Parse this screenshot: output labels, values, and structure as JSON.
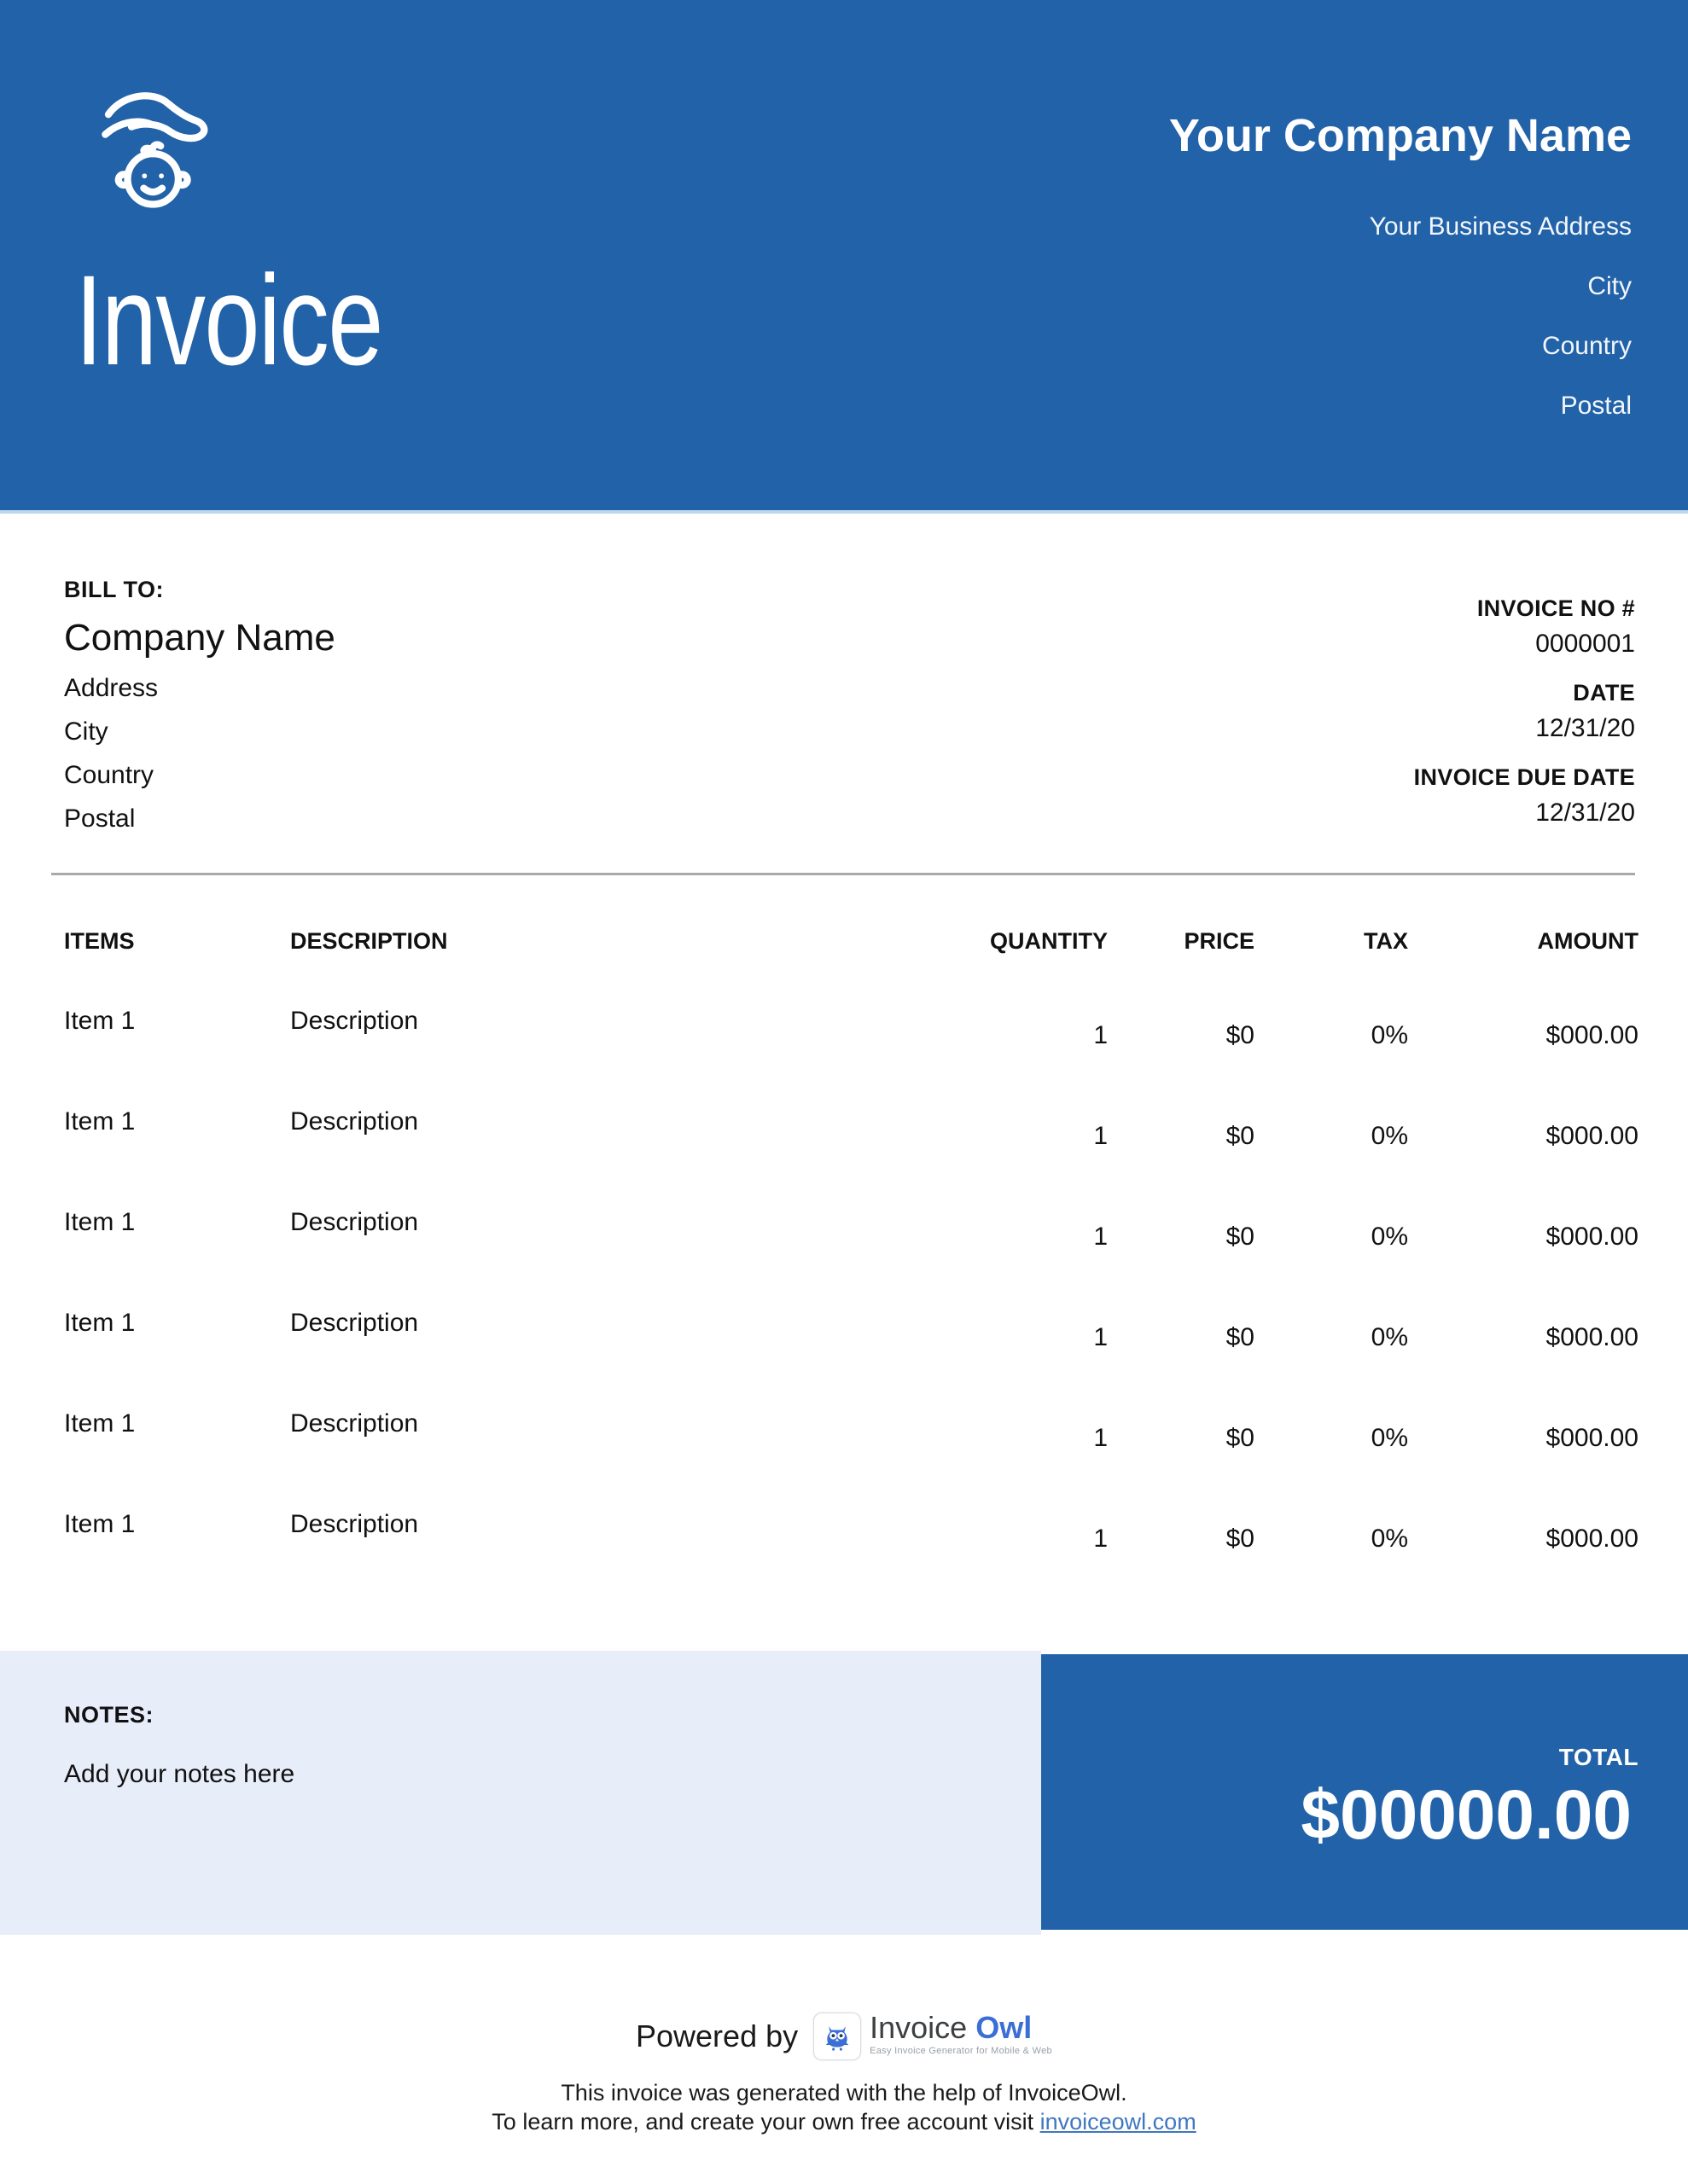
{
  "header": {
    "title": "Invoice",
    "company_name": "Your Company Name",
    "address_line1": "Your Business Address",
    "address_line2": "City",
    "address_line3": "Country",
    "address_line4": "Postal"
  },
  "bill_to": {
    "label": "BILL TO:",
    "company": "Company Name",
    "line1": "Address",
    "line2": "City",
    "line3": "Country",
    "line4": "Postal"
  },
  "meta": {
    "invoice_no_label": "INVOICE NO #",
    "invoice_no": "0000001",
    "date_label": "DATE",
    "date": "12/31/20",
    "due_label": "INVOICE DUE DATE",
    "due_date": "12/31/20"
  },
  "table": {
    "headers": {
      "items": "ITEMS",
      "description": "DESCRIPTION",
      "quantity": "QUANTITY",
      "price": "PRICE",
      "tax": "TAX",
      "amount": "AMOUNT"
    },
    "rows": [
      {
        "item": "Item 1",
        "description": "Description",
        "quantity": "1",
        "price": "$0",
        "tax": "0%",
        "amount": "$000.00"
      },
      {
        "item": "Item 1",
        "description": "Description",
        "quantity": "1",
        "price": "$0",
        "tax": "0%",
        "amount": "$000.00"
      },
      {
        "item": "Item 1",
        "description": "Description",
        "quantity": "1",
        "price": "$0",
        "tax": "0%",
        "amount": "$000.00"
      },
      {
        "item": "Item 1",
        "description": "Description",
        "quantity": "1",
        "price": "$0",
        "tax": "0%",
        "amount": "$000.00"
      },
      {
        "item": "Item 1",
        "description": "Description",
        "quantity": "1",
        "price": "$0",
        "tax": "0%",
        "amount": "$000.00"
      },
      {
        "item": "Item 1",
        "description": "Description",
        "quantity": "1",
        "price": "$0",
        "tax": "0%",
        "amount": "$000.00"
      }
    ]
  },
  "notes": {
    "label": "NOTES:",
    "text": "Add your notes here"
  },
  "total": {
    "label": "TOTAL",
    "value": "$00000.00"
  },
  "footer": {
    "powered_by": "Powered by",
    "logo_invoice": "Invoice",
    "logo_owl": "Owl",
    "logo_tagline": "Easy Invoice Generator for Mobile & Web",
    "line1": "This invoice was generated with the help of InvoiceOwl.",
    "line2_prefix": "To learn more, and create your own free account visit ",
    "link": "invoiceowl.com"
  },
  "colors": {
    "primary_blue": "#2262a8",
    "notes_background": "#e8edfa",
    "header_edge": "#bcd6ec",
    "link_blue": "#4077c0",
    "logo_blue": "#3b6fd6"
  }
}
